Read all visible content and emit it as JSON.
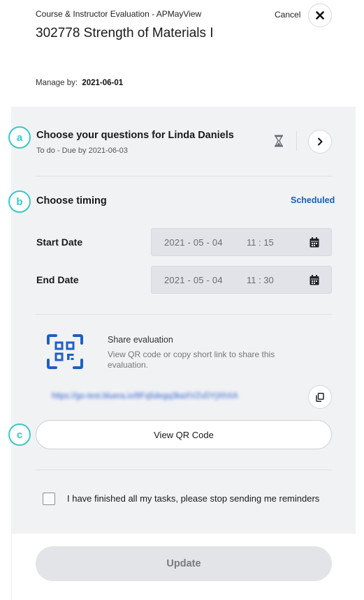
{
  "header": {
    "app_title": "Course & Instructor Evaluation - APMayView",
    "course_title": "302778 Strength of Materials I",
    "cancel_label": "Cancel",
    "manage_label": "Manage by:",
    "manage_date": "2021-06-01"
  },
  "steps": {
    "a": "a",
    "b": "b",
    "c": "c"
  },
  "questions": {
    "title": "Choose your questions for Linda Daniels",
    "subtitle": "To do - Due by 2021-06-03"
  },
  "timing": {
    "title": "Choose timing",
    "mode": "Scheduled",
    "start_label": "Start Date",
    "start_date": "2021 - 05 - 04",
    "start_time": "11 : 15",
    "end_label": "End Date",
    "end_date": "2021 - 05 - 04",
    "end_time": "11 : 30"
  },
  "share": {
    "title": "Share evaluation",
    "description": "View QR code or copy short link to share this evaluation.",
    "link": "https://go-test.bluera.io/8Fq5degq3kaXVZvDYjXhXA",
    "qr_button": "View QR Code"
  },
  "reminder": {
    "label": "I have finished all my tasks, please stop sending me reminders",
    "checked": false
  },
  "footer": {
    "update_label": "Update"
  },
  "colors": {
    "accent_teal": "#39c8c8",
    "link_blue": "#1b5fb3",
    "qr_blue": "#1e5fc2"
  }
}
